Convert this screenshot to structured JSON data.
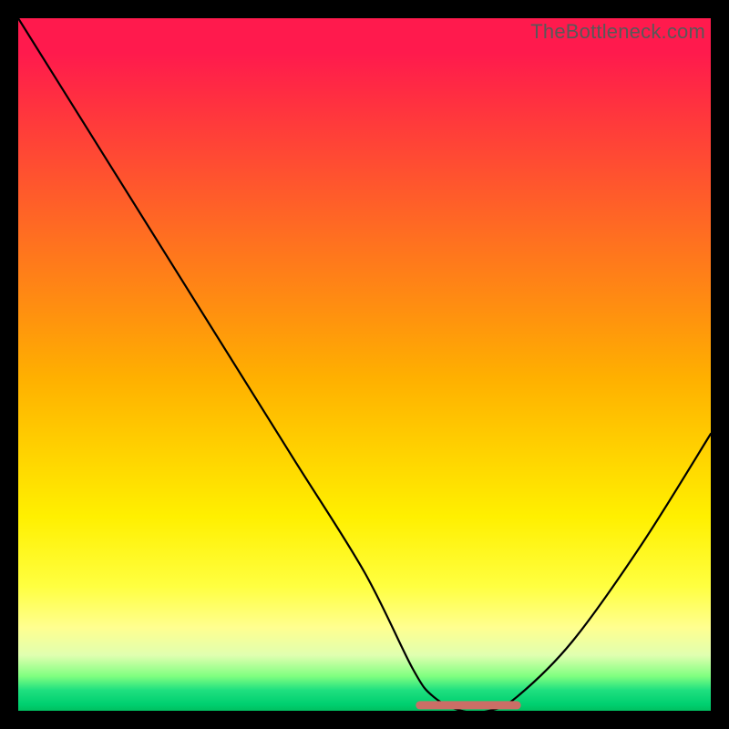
{
  "watermark": "TheBottleneck.com",
  "chart_data": {
    "type": "line",
    "title": "",
    "xlabel": "",
    "ylabel": "",
    "xlim": [
      0,
      100
    ],
    "ylim": [
      0,
      100
    ],
    "series": [
      {
        "name": "bottleneck-curve",
        "x": [
          0,
          10,
          20,
          30,
          40,
          50,
          57,
          60,
          64,
          68,
          72,
          80,
          90,
          100
        ],
        "values": [
          100,
          84,
          68,
          52,
          36,
          20,
          6,
          2,
          0,
          0,
          2,
          10,
          24,
          40
        ]
      }
    ],
    "marker": {
      "name": "optimal-range-marker",
      "x_start": 58,
      "x_end": 72,
      "y": 0.8,
      "color": "#cc6e66",
      "thickness": 9
    },
    "gradient_stops": [
      {
        "pos": 0,
        "color": "#ff1a4d"
      },
      {
        "pos": 50,
        "color": "#ffd000"
      },
      {
        "pos": 85,
        "color": "#ffff60"
      },
      {
        "pos": 100,
        "color": "#00c060"
      }
    ]
  }
}
